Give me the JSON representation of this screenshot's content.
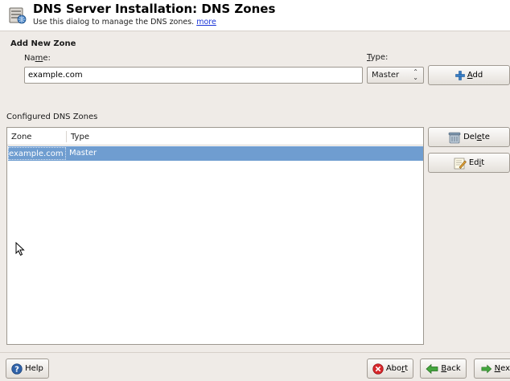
{
  "header": {
    "title": "DNS Server Installation: DNS Zones",
    "subtitle": "Use this dialog to manage the DNS zones.",
    "more_link": "more"
  },
  "add_zone": {
    "section_title": "Add New Zone",
    "name_label_pre": "Na",
    "name_label_mnemonic": "m",
    "name_label_post": "e:",
    "name_value": "example.com",
    "type_label_pre": "",
    "type_label_mnemonic": "T",
    "type_label_post": "ype:",
    "type_value": "Master",
    "add_button_mnemonic": "A",
    "add_button_post": "dd"
  },
  "zones": {
    "section_label": "Configured DNS Zones",
    "columns": [
      "Zone",
      "Type"
    ],
    "rows": [
      {
        "zone": "example.com",
        "type": "Master"
      }
    ]
  },
  "side_buttons": {
    "delete_pre": "Del",
    "delete_mnemonic": "e",
    "delete_post": "te",
    "edit_pre": "Ed",
    "edit_mnemonic": "i",
    "edit_post": "t"
  },
  "footer": {
    "help": "Help",
    "abort_pre": "Abo",
    "abort_mnemonic": "r",
    "abort_post": "t",
    "back_mnemonic": "B",
    "back_post": "ack",
    "next_mnemonic": "N",
    "next_post": "ex"
  }
}
